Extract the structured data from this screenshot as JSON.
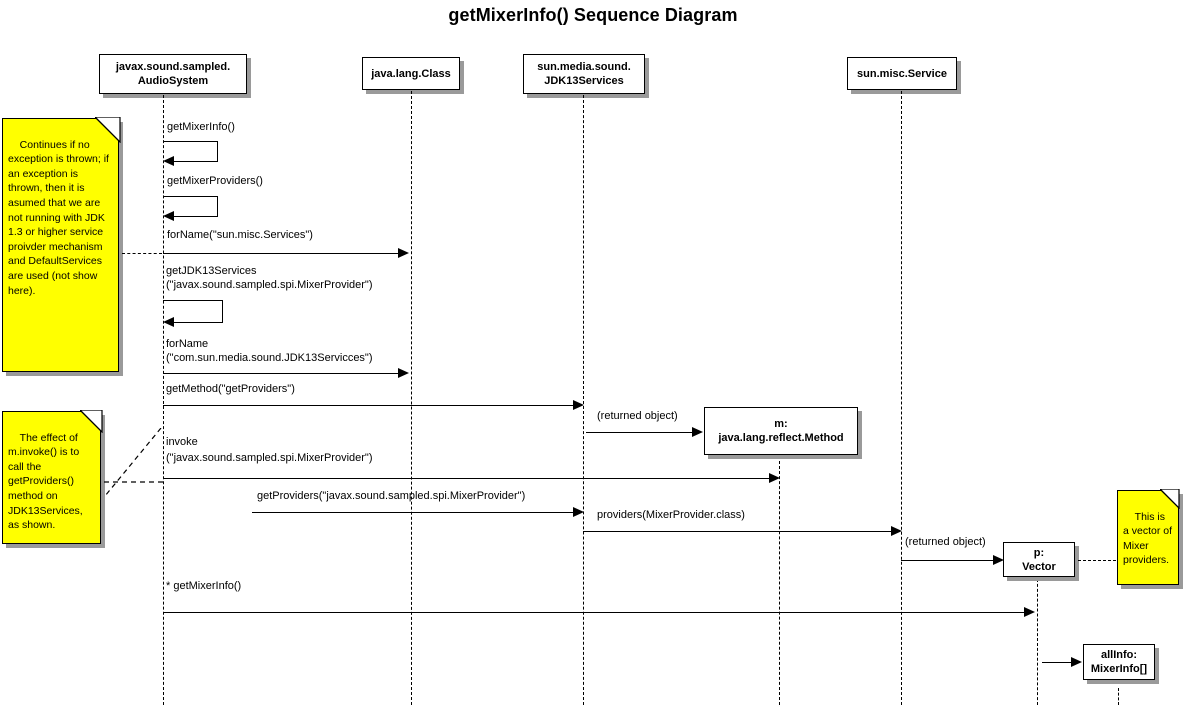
{
  "diagram": {
    "title": "getMixerInfo() Sequence Diagram",
    "type": "uml-sequence-diagram",
    "colors": {
      "note_fill": "#ffff00",
      "note_border": "#000000",
      "box_fill": "#ffffff",
      "box_border": "#000000",
      "shadow": "#9a9a9a",
      "line": "#000000",
      "background": "#ffffff"
    }
  },
  "participants": [
    {
      "id": "audiosystem",
      "line1": "javax.sound.sampled.",
      "line2": "AudioSystem"
    },
    {
      "id": "javalangclass",
      "line1": "java.lang.Class",
      "line2": ""
    },
    {
      "id": "jdk13services",
      "line1": "sun.media.sound.",
      "line2": "JDK13Services"
    },
    {
      "id": "suncmiscservice",
      "line1": "sun.misc.Service",
      "line2": ""
    }
  ],
  "object_boxes": [
    {
      "id": "method-object",
      "line1": "m:",
      "line2": "java.lang.reflect.Method"
    },
    {
      "id": "vector-object",
      "line1": "p:",
      "line2": "Vector"
    },
    {
      "id": "allinfo-object",
      "line1": "allInfo:",
      "line2": "MixerInfo[]"
    }
  ],
  "notes": [
    {
      "id": "note-exception",
      "text": "Continues if no exception is thrown; if an exception is thrown, then it is asumed that we are not running with JDK 1.3 or higher service proivder mechanism and DefaultServices are used (not show here)."
    },
    {
      "id": "note-invoke",
      "text": "The effect of m.invoke() is to call the getProviders() method on JDK13Services, as shown."
    },
    {
      "id": "note-vector",
      "text": "This is a vector of Mixer providers."
    }
  ],
  "messages": [
    {
      "id": "msg-getmixerinfo",
      "label": "getMixerInfo()",
      "kind": "self-call"
    },
    {
      "id": "msg-getmixerproviders",
      "label": "getMixerProviders()",
      "kind": "self-call"
    },
    {
      "id": "msg-forname-services",
      "label": "forName(\"sun.misc.Services\")",
      "kind": "call",
      "from": "audiosystem",
      "to": "javalangclass"
    },
    {
      "id": "msg-getjdk13services",
      "label_line1": "getJDK13Services",
      "label_line2": "(\"javax.sound.sampled.spi.MixerProvider\")",
      "kind": "self-call"
    },
    {
      "id": "msg-forname-jdk13",
      "label_line1": "forName",
      "label_line2": "(\"com.sun.media.sound.JDK13Servicces\")",
      "kind": "call",
      "from": "audiosystem",
      "to": "javalangclass"
    },
    {
      "id": "msg-getmethod",
      "label": "getMethod(\"getProviders\")",
      "kind": "call",
      "from": "audiosystem",
      "to": "jdk13services"
    },
    {
      "id": "msg-returned-method",
      "label": "(returned object)",
      "kind": "return",
      "from": "jdk13services",
      "to": "method-object"
    },
    {
      "id": "msg-invoke",
      "label_line1": "invoke",
      "label_line2": "(\"javax.sound.sampled.spi.MixerProvider\")",
      "kind": "call",
      "from": "audiosystem",
      "to": "method-object"
    },
    {
      "id": "msg-getproviders",
      "label": "getProviders(\"javax.sound.sampled.spi.MixerProvider\")",
      "kind": "call",
      "from": "audiosystem",
      "to": "jdk13services"
    },
    {
      "id": "msg-providers",
      "label": "providers(MixerProvider.class)",
      "kind": "call",
      "from": "jdk13services",
      "to": "suncmiscservice"
    },
    {
      "id": "msg-returned-vector",
      "label": "(returned object)",
      "kind": "return",
      "from": "suncmiscservice",
      "to": "vector-object"
    },
    {
      "id": "msg-star-getmixerinfo",
      "label": "* getMixerInfo()",
      "kind": "call",
      "from": "audiosystem",
      "to": "vector-object"
    },
    {
      "id": "msg-allinfo",
      "label": "",
      "kind": "create",
      "from": "vector-object",
      "to": "allinfo-object"
    }
  ]
}
